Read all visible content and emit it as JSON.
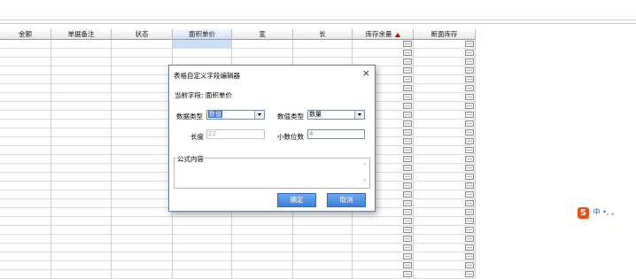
{
  "toolbar": {
    "hint_text": "​​​​​​"
  },
  "grid": {
    "columns": [
      "金额",
      "单据备注",
      "状态",
      "面积单价",
      "宽",
      "长",
      "库存余量",
      "断面库存"
    ],
    "active_column": "面积单价",
    "sorted_column": "库存余量",
    "ellipsis_label": "...",
    "row_count": 27
  },
  "dialog": {
    "title": "表格自定义字段编辑器",
    "current_field_label": "当前字段:",
    "current_field_value": "面积单价",
    "data_type_label": "数据类型",
    "data_type_value": "数值",
    "value_type_label": "数值类型",
    "value_type_value": "数量",
    "length_label": "长度",
    "length_value": "22",
    "decimals_label": "小数位数",
    "decimals_value": "4",
    "formula_label": "公式内容",
    "formula_value": "",
    "confirm_label": "确定",
    "cancel_label": "取消",
    "close_glyph": "×"
  },
  "ime": {
    "logo": "S",
    "text": "中 •, 。"
  }
}
